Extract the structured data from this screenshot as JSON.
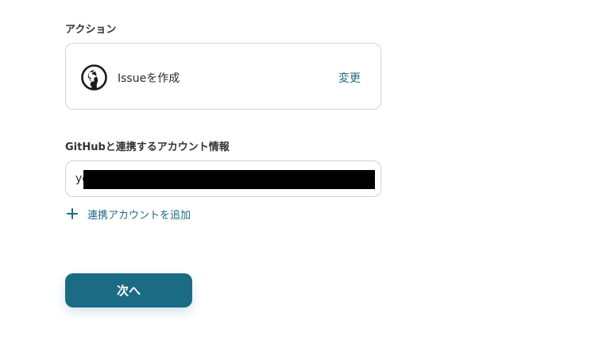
{
  "action_section": {
    "label": "アクション",
    "action_name": "Issueを作成",
    "change_label": "変更",
    "icon": "github-icon"
  },
  "account_section": {
    "label": "GitHubと連携するアカウント情報",
    "value_prefix": "yo",
    "redacted": true,
    "add_account_label": "連携アカウントを追加",
    "add_icon": "plus-icon"
  },
  "footer": {
    "next_label": "次へ"
  },
  "colors": {
    "accent": "#1e6a86",
    "button": "#1b6b85",
    "border": "#cfd3d8"
  }
}
